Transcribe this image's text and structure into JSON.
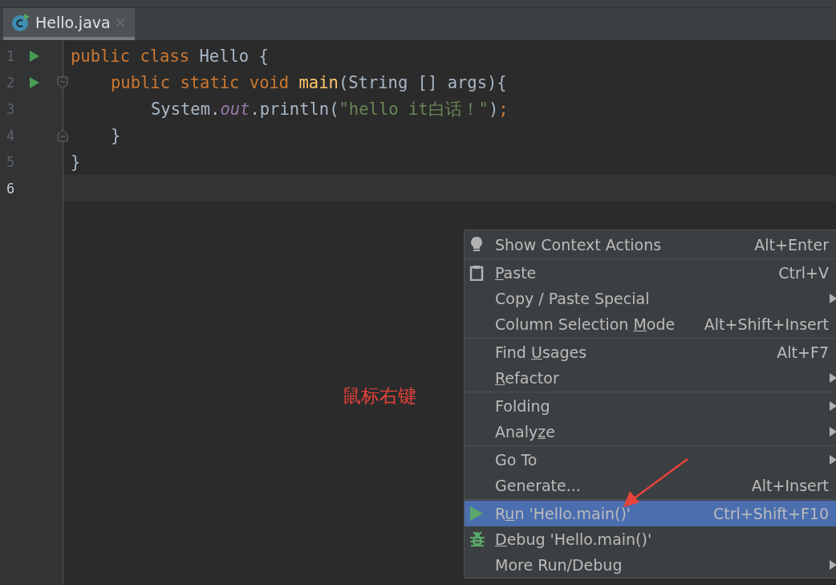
{
  "tabs": [
    {
      "label": "Hello.java",
      "selected": true
    }
  ],
  "code": {
    "lines": [
      {
        "number": "1",
        "run": true,
        "fold_start": false,
        "fold_end": false,
        "current": false,
        "tokens": [
          {
            "kind": "keyword",
            "text": "public class "
          },
          {
            "kind": "plain",
            "text": "Hello {"
          }
        ],
        "children": [
          {
            "number": "2",
            "run": true,
            "fold_start": true,
            "fold_end": false,
            "current": false,
            "tokens": [
              {
                "kind": "keyword",
                "text": "public static void "
              },
              {
                "kind": "method",
                "text": "main"
              },
              {
                "kind": "plain",
                "text": "(String [] args){"
              }
            ],
            "children": [
              {
                "number": "3",
                "run": false,
                "fold_start": false,
                "fold_end": false,
                "current": false,
                "tokens": [
                  {
                    "kind": "plain",
                    "text": "System."
                  },
                  {
                    "kind": "field",
                    "text": "out"
                  },
                  {
                    "kind": "plain",
                    "text": ".println("
                  },
                  {
                    "kind": "string",
                    "text": "\"hello it白话！\""
                  },
                  {
                    "kind": "plain",
                    "text": ")"
                  },
                  {
                    "kind": "keyword",
                    "text": ";"
                  }
                ]
              }
            ]
          },
          {
            "number": "4",
            "run": false,
            "fold_start": false,
            "fold_end": true,
            "current": false,
            "tokens": [
              {
                "kind": "plain",
                "text": "}"
              }
            ]
          }
        ]
      },
      {
        "number": "5",
        "run": false,
        "fold_start": false,
        "fold_end": false,
        "current": false,
        "tokens": [
          {
            "kind": "plain",
            "text": "}"
          }
        ]
      },
      {
        "number": "6",
        "run": false,
        "fold_start": false,
        "fold_end": false,
        "current": true
      }
    ]
  },
  "annotation": {
    "text": "鼠标右键"
  },
  "context_menu": {
    "groups": [
      {
        "items": [
          {
            "kind": "bulb",
            "label_after": "Show Context Actions",
            "shortcut": "Alt+Enter",
            "submenu": false,
            "selected": false
          }
        ]
      },
      {
        "items": [
          {
            "kind": "clipboard",
            "mnemonic": "P",
            "label_after": "aste",
            "shortcut": "Ctrl+V",
            "submenu": false,
            "selected": false
          },
          {
            "kind": "plain",
            "label_after": "Copy / Paste Special",
            "submenu": true,
            "selected": false
          },
          {
            "kind": "plain",
            "label_before": "Column Selection ",
            "mnemonic": "M",
            "label_after": "ode",
            "shortcut": "Alt+Shift+Insert",
            "submenu": false,
            "selected": false
          }
        ]
      },
      {
        "items": [
          {
            "kind": "plain",
            "label_before": "Find ",
            "mnemonic": "U",
            "label_after": "sages",
            "shortcut": "Alt+F7",
            "submenu": false,
            "selected": false
          },
          {
            "kind": "plain",
            "mnemonic": "R",
            "label_after": "efactor",
            "submenu": true,
            "selected": false
          }
        ]
      },
      {
        "items": [
          {
            "kind": "plain",
            "label_after": "Folding",
            "submenu": true,
            "selected": false
          },
          {
            "kind": "plain",
            "label_before": "Analy",
            "mnemonic": "z",
            "label_after": "e",
            "submenu": true,
            "selected": false
          }
        ]
      },
      {
        "items": [
          {
            "kind": "plain",
            "label_after": "Go To",
            "submenu": true,
            "selected": false
          },
          {
            "kind": "plain",
            "label_after": "Generate...",
            "shortcut": "Alt+Insert",
            "submenu": false,
            "selected": false
          }
        ]
      },
      {
        "items": [
          {
            "kind": "run",
            "label_before": "R",
            "mnemonic": "u",
            "label_after": "n 'Hello.main()'",
            "shortcut": "Ctrl+Shift+F10",
            "submenu": false,
            "selected": true
          },
          {
            "kind": "debug",
            "mnemonic": "D",
            "label_after": "ebug 'Hello.main()'",
            "submenu": false,
            "selected": false
          },
          {
            "kind": "plain",
            "label_after": "More Run/Debug",
            "submenu": true,
            "selected": false
          }
        ]
      }
    ]
  }
}
